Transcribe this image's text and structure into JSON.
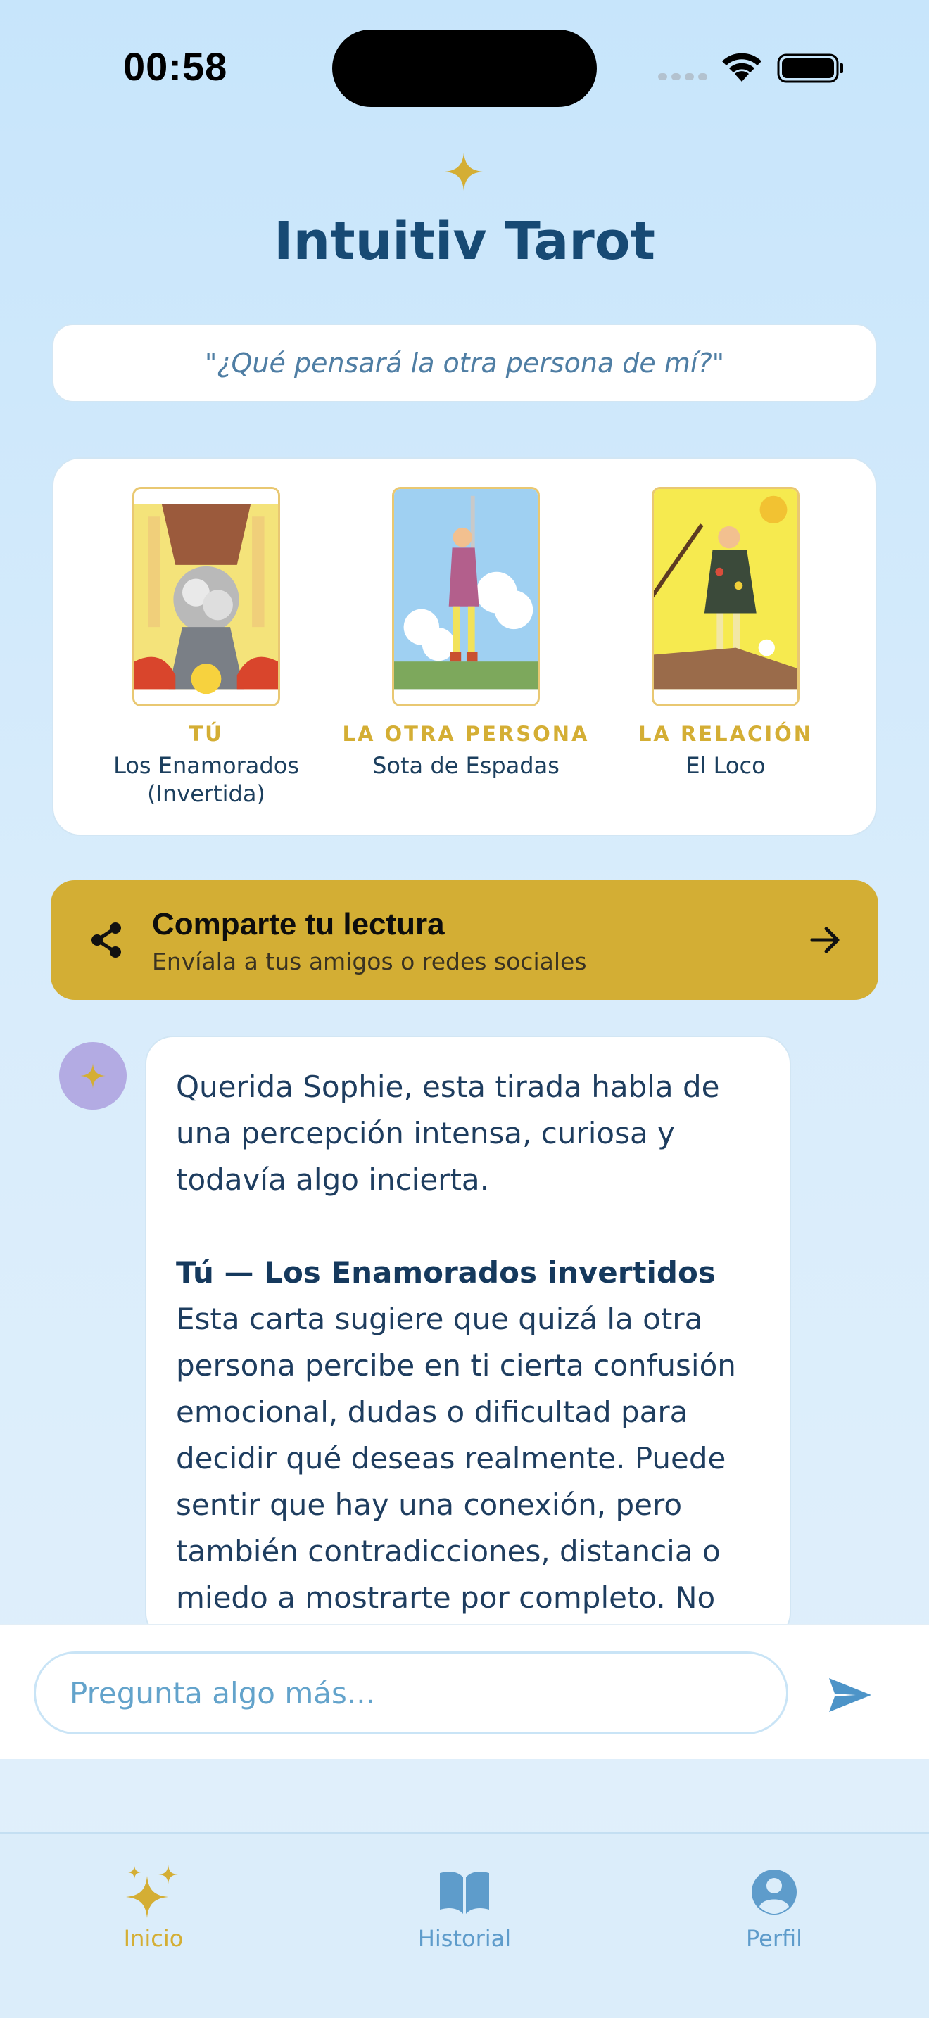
{
  "status_bar": {
    "time": "00:58"
  },
  "header": {
    "title": "Intuitiv Tarot",
    "sparkle_icon": "sparkle-icon"
  },
  "question": "\"¿Qué pensará la otra persona de mí?\"",
  "cards": [
    {
      "role": "TÚ",
      "name": "Los Enamorados (Invertida)"
    },
    {
      "role": "LA OTRA PERSONA",
      "name": "Sota de Espadas"
    },
    {
      "role": "LA RELACIÓN",
      "name": "El Loco"
    }
  ],
  "share": {
    "title": "Comparte tu lectura",
    "subtitle": "Envíala a tus amigos o redes sociales"
  },
  "message": {
    "intro": "Querida Sophie, esta tirada habla de una percepción intensa, curiosa y todavía algo incierta.",
    "section_title": "Tú — Los Enamorados invertidos",
    "section_body": "Esta carta sugiere que quizá la otra persona percibe en ti cierta confusión emocional, dudas o dificultad para decidir qué deseas realmente. Puede sentir que hay una conexión, pero también contradicciones, distancia o miedo a mostrarte por completo. No"
  },
  "input": {
    "placeholder": "Pregunta algo más..."
  },
  "tabs": [
    {
      "label": "Inicio",
      "icon": "sparkles-icon",
      "active": true
    },
    {
      "label": "Historial",
      "icon": "book-icon",
      "active": false
    },
    {
      "label": "Perfil",
      "icon": "profile-icon",
      "active": false
    }
  ],
  "colors": {
    "accent_gold": "#d3ae34",
    "title_blue": "#174a74",
    "link_blue": "#5e9ccb",
    "bot_avatar": "#b3abe3"
  }
}
